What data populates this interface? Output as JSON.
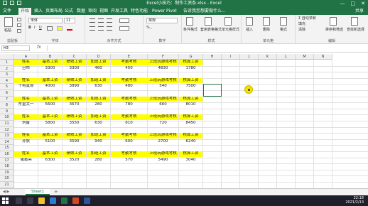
{
  "titlebar": {
    "title": "Excel小技巧：制作工资条.xlsx - Excel",
    "minimize": "—",
    "maximize": "□",
    "close": "✕"
  },
  "tabs": [
    "文件",
    "开始",
    "插入",
    "页面布局",
    "公式",
    "数据",
    "审阅",
    "视图",
    "开发工具",
    "特色功能",
    "Power Pivot",
    "告诉我您想要做什么..."
  ],
  "share_label": "共享",
  "ribbon": {
    "clipboard": {
      "label": "剪贴板",
      "paste": "粘贴"
    },
    "font": {
      "label": "字体",
      "font_name": "宋体",
      "font_size": "11"
    },
    "alignment": {
      "label": "对齐方式"
    },
    "number": {
      "label": "数字",
      "format": "常规"
    },
    "styles": {
      "label": "样式",
      "conditional": "条件格式",
      "table": "套用表格格式",
      "cell_styles": "单元格样式"
    },
    "cells": {
      "label": "单元格",
      "insert": "插入",
      "delete": "删除",
      "format": "格式"
    },
    "editing": {
      "label": "编辑",
      "sum": "Σ 自动求和",
      "fill": "填充",
      "clear": "清除",
      "sort": "排序和筛选",
      "find": "查找和选择"
    }
  },
  "formula_bar": {
    "name_box": "H3",
    "fx": "fx",
    "value": ""
  },
  "columns": [
    "A",
    "B",
    "C",
    "D",
    "E",
    "F",
    "G",
    "H",
    "I",
    "J",
    "K",
    "L",
    "M",
    "N"
  ],
  "headers": [
    "姓名",
    "基本工资",
    "绩效工资",
    "加班工资",
    "考勤考核",
    "上班玩游戏考核",
    "核算工资"
  ],
  "rows": [
    [
      "1",
      "2",
      "3",
      "4",
      "5",
      "6",
      "7",
      "8",
      "9",
      "10",
      "11",
      "12",
      "13",
      "14",
      "15",
      "16",
      "17",
      "18",
      "19",
      "20",
      "21",
      "22"
    ]
  ],
  "records": [
    {
      "name": "吕布",
      "values": [
        "3300",
        "3300",
        "460",
        "450",
        "4830",
        "1780"
      ]
    },
    {
      "name": "干将莫邪",
      "values": [
        "4000",
        "3890",
        "630",
        "480",
        "540",
        "7500"
      ]
    },
    {
      "name": "东皇太一",
      "values": [
        "5600",
        "3670",
        "280",
        "780",
        "660",
        "8010"
      ]
    },
    {
      "name": "刘备",
      "values": [
        "5800",
        "3550",
        "630",
        "810",
        "720",
        "8450"
      ]
    },
    {
      "name": "孙膑",
      "values": [
        "5100",
        "3590",
        "940",
        "600",
        "2700",
        "6240"
      ]
    },
    {
      "name": "诸葛亮",
      "values": [
        "6300",
        "3520",
        "280",
        "570",
        "5490",
        "3040"
      ]
    }
  ],
  "sheet_tab": "Sheet1",
  "sheet_add": "+",
  "taskbar": {
    "time": "22:18",
    "date": "2021/2/13"
  },
  "colors": {
    "excel_green": "#217346",
    "header_fill": "#ffff00",
    "cursor": "#f4e200"
  }
}
